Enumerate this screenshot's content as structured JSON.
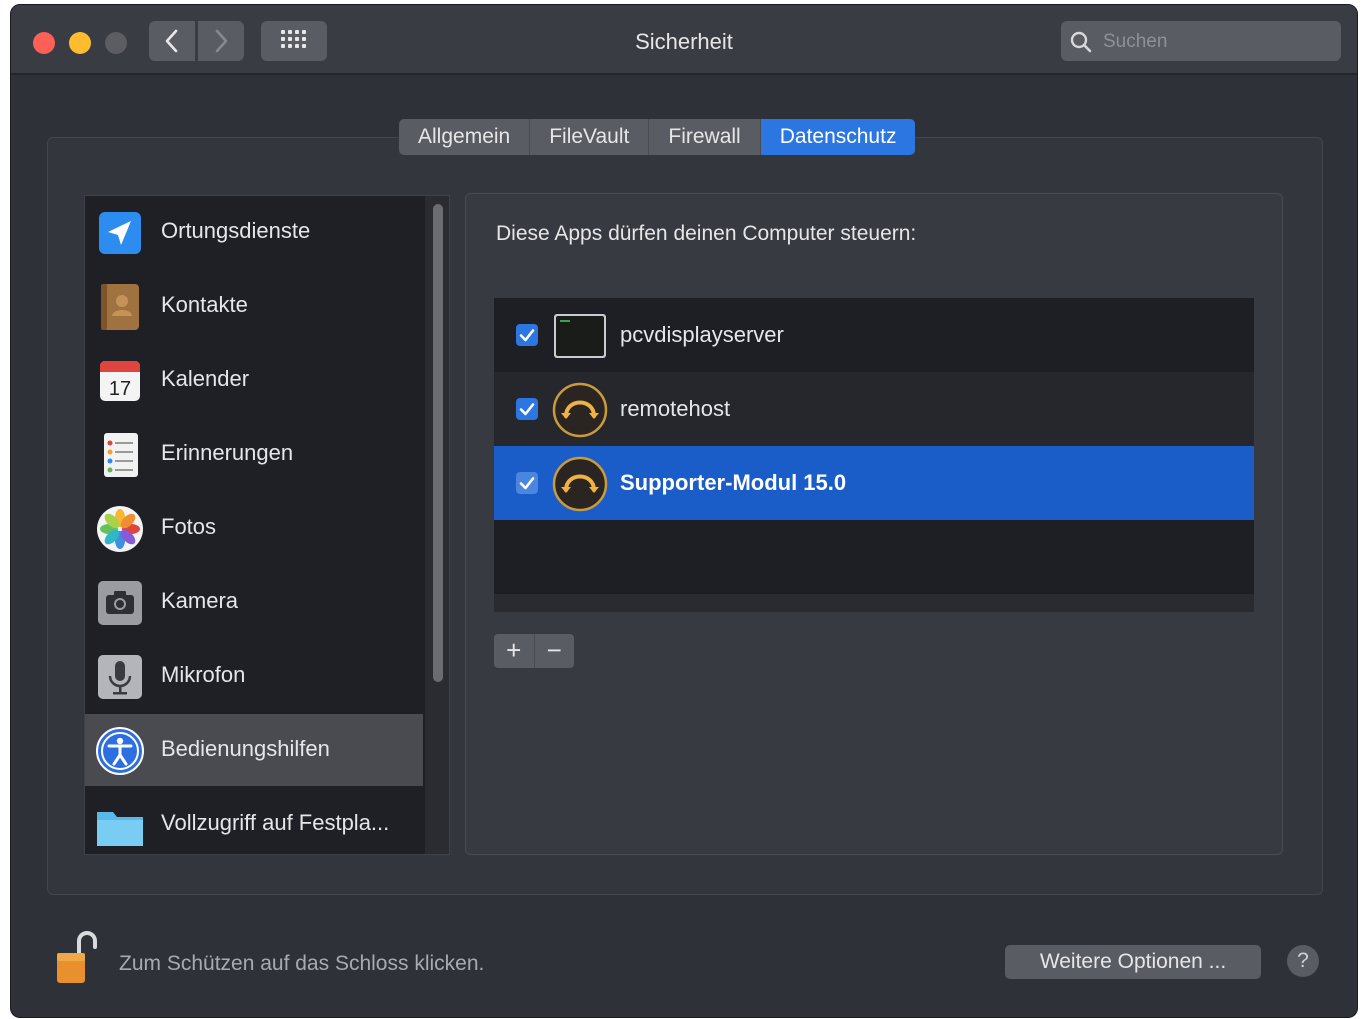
{
  "window": {
    "title": "Sicherheit",
    "accent_color": "#2c76e2"
  },
  "toolbar": {
    "back_icon": "chevron-left-icon",
    "forward_icon": "chevron-right-icon",
    "grid_icon": "grid-icon",
    "search_placeholder": "Suchen"
  },
  "tabs": [
    {
      "label": "Allgemein",
      "active": false
    },
    {
      "label": "FileVault",
      "active": false
    },
    {
      "label": "Firewall",
      "active": false
    },
    {
      "label": "Datenschutz",
      "active": true
    }
  ],
  "sidebar": {
    "items": [
      {
        "label": "Ortungsdienste",
        "icon": "location-arrow-icon"
      },
      {
        "label": "Kontakte",
        "icon": "contacts-book-icon"
      },
      {
        "label": "Kalender",
        "icon": "calendar-icon",
        "icon_text": "17"
      },
      {
        "label": "Erinnerungen",
        "icon": "reminders-icon"
      },
      {
        "label": "Fotos",
        "icon": "photos-icon"
      },
      {
        "label": "Kamera",
        "icon": "camera-icon"
      },
      {
        "label": "Mikrofon",
        "icon": "microphone-icon"
      },
      {
        "label": "Bedienungshilfen",
        "icon": "accessibility-icon",
        "selected": true
      },
      {
        "label": "Vollzugriff auf Festpla...",
        "icon": "folder-icon"
      }
    ]
  },
  "panel": {
    "heading": "Diese Apps dürfen deinen Computer steuern:",
    "apps": [
      {
        "name": "pcvdisplayserver",
        "checked": true,
        "icon": "terminal-icon"
      },
      {
        "name": "remotehost",
        "checked": true,
        "icon": "remote-support-icon"
      },
      {
        "name": "Supporter-Modul 15.0",
        "checked": true,
        "icon": "remote-support-icon",
        "selected": true
      }
    ],
    "add_label": "+",
    "remove_label": "−"
  },
  "footer": {
    "lock_hint": "Zum Schützen auf das Schloss klicken.",
    "more_options": "Weitere Optionen ...",
    "help_label": "?"
  }
}
